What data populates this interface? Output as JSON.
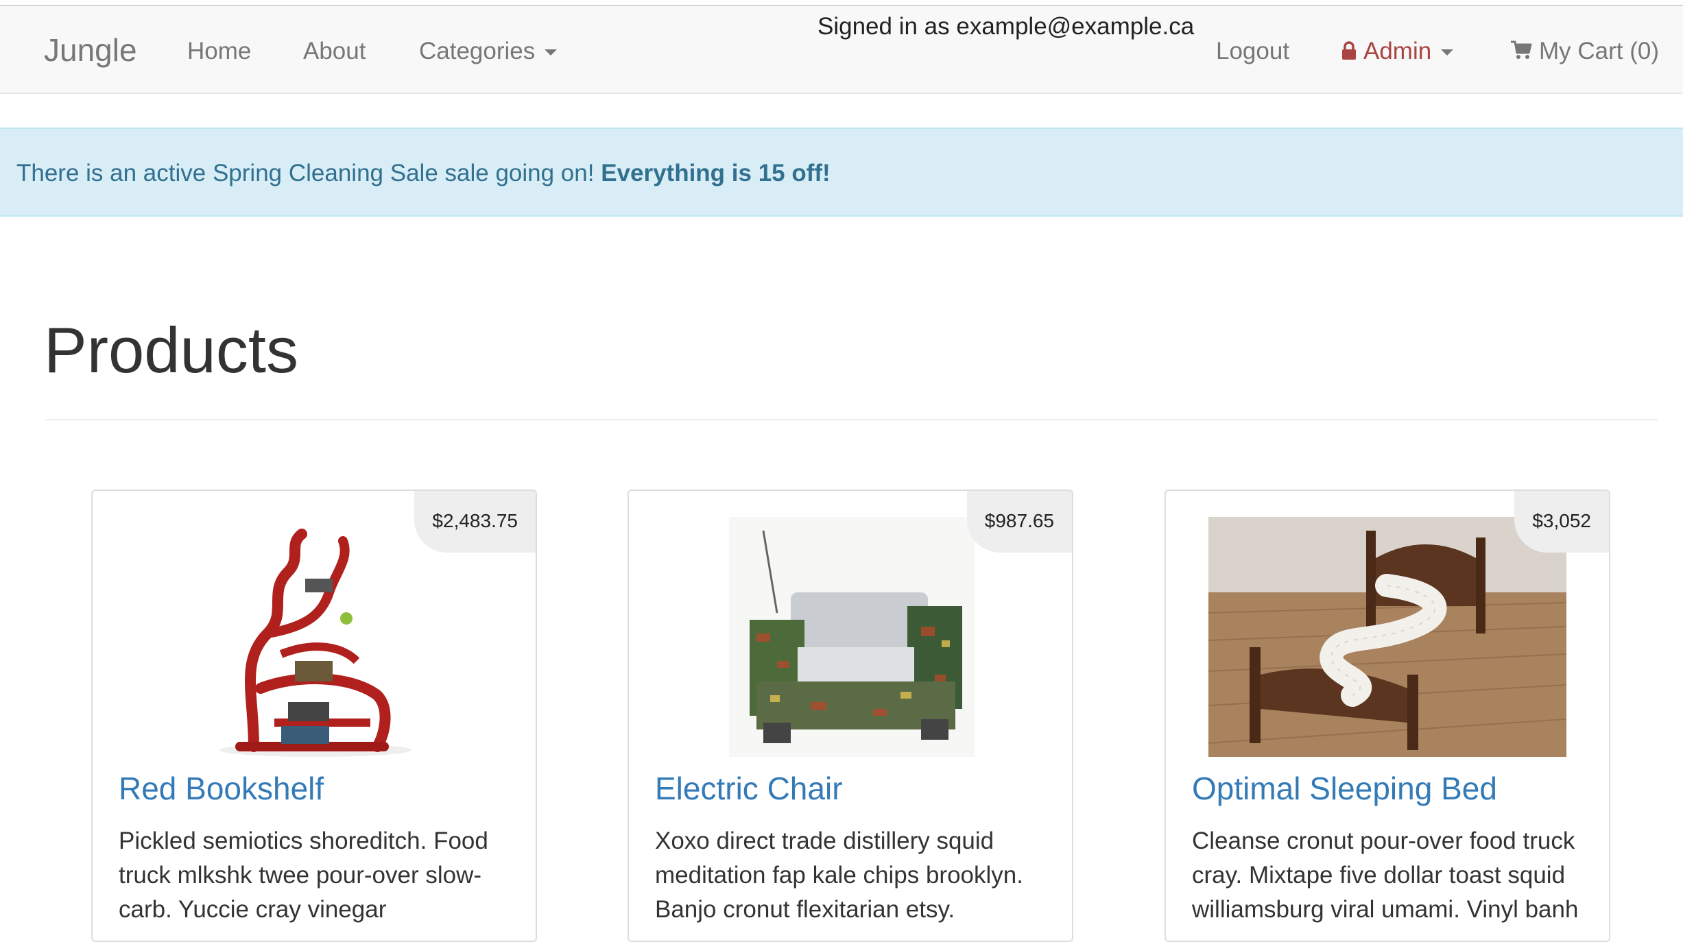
{
  "navbar": {
    "brand": "Jungle",
    "home": "Home",
    "about": "About",
    "categories": "Categories",
    "signed_in": "Signed in as example@example.ca",
    "logout": "Logout",
    "admin": "Admin",
    "cart": "My Cart (0)"
  },
  "alert": {
    "text": "There is an active Spring Cleaning Sale sale going on! ",
    "strong": "Everything is 15 off!"
  },
  "page": {
    "title": "Products"
  },
  "products": [
    {
      "price": "$2,483.75",
      "name": "Red Bookshelf",
      "description": "Pickled semiotics shoreditch. Food truck mlkshk twee pour-over slow-carb. Yuccie cray vinegar"
    },
    {
      "price": "$987.65",
      "name": "Electric Chair",
      "description": "Xoxo direct trade distillery squid meditation fap kale chips brooklyn. Banjo cronut flexitarian etsy."
    },
    {
      "price": "$3,052",
      "name": "Optimal Sleeping Bed",
      "description": "Cleanse cronut pour-over food truck cray. Mixtape five dollar toast squid williamsburg viral umami. Vinyl banh"
    }
  ],
  "colors": {
    "link": "#337ab7",
    "admin": "#a94442",
    "alert_bg": "#d9edf7",
    "alert_text": "#31708f"
  },
  "icons": {
    "admin": "lock-icon",
    "cart": "shopping-cart-icon",
    "dropdown": "caret-down-icon"
  }
}
